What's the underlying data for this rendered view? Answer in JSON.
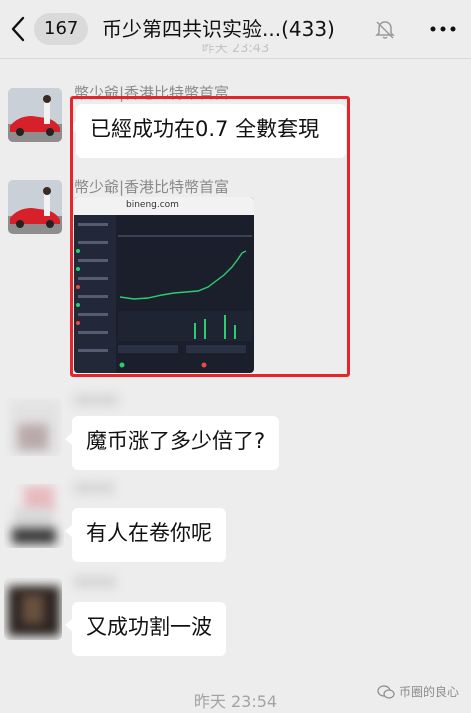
{
  "header": {
    "unread_badge": "167",
    "title": "币少第四共识实验...(433)"
  },
  "ghost_time": "昨天 23:43",
  "messages": [
    {
      "nickname": "幣少爺|香港比特幣首富",
      "text": "已經成功在0.7 全數套現"
    },
    {
      "nickname": "幣少爺|香港比特幣首富",
      "screenshot_url": "bineng.com"
    },
    {
      "text": "魔币涨了多少倍了?"
    },
    {
      "text": "有人在卷你呢"
    },
    {
      "text": "又成功割一波"
    }
  ],
  "timestamp": "昨天 23:54",
  "watermark": "币圈的良心",
  "colors": {
    "background": "#ededed",
    "highlight": "#e5252a",
    "chart_line": "#2ecc71"
  }
}
